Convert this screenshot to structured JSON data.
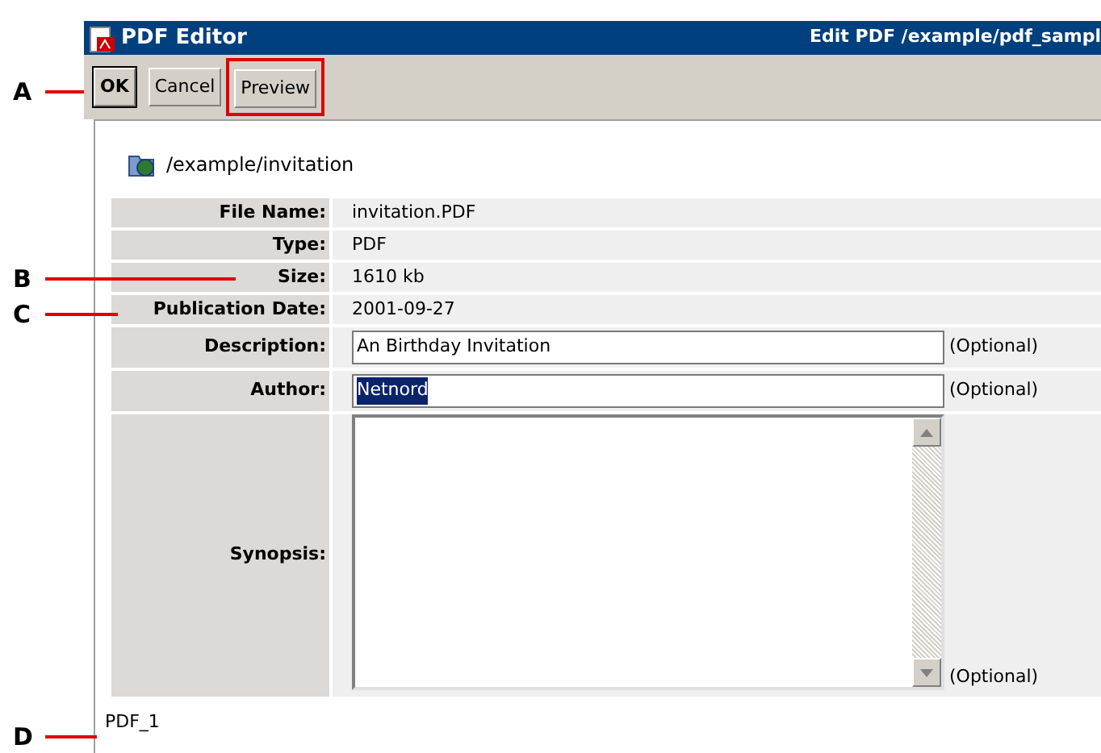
{
  "window": {
    "title": "PDF Editor",
    "subtitle": "Edit PDF /example/pdf_sampl"
  },
  "buttons": [
    {
      "label": "OK",
      "default": true,
      "highlighted": false
    },
    {
      "label": "Cancel",
      "default": false,
      "highlighted": false
    },
    {
      "label": "Preview",
      "default": false,
      "highlighted": true
    }
  ],
  "path": "/example/invitation",
  "fields": [
    {
      "kind": "static",
      "label": "File Name:",
      "value": "invitation.PDF"
    },
    {
      "kind": "static",
      "label": "Type:",
      "value": "PDF"
    },
    {
      "kind": "static",
      "label": "Size:",
      "value": "1610 kb"
    },
    {
      "kind": "static",
      "label": "Publication Date:",
      "value": "2001-09-27"
    },
    {
      "kind": "input",
      "label": "Description:",
      "value": "An Birthday Invitation",
      "selected": false,
      "note": "(Optional)"
    },
    {
      "kind": "input",
      "label": "Author:",
      "value": "Netnord",
      "selected": true,
      "note": "(Optional)"
    },
    {
      "kind": "textarea",
      "label": "Synopsis:",
      "note": "(Optional)"
    }
  ],
  "footer": "PDF_1",
  "callouts": [
    {
      "label": "A"
    },
    {
      "label": "B"
    },
    {
      "label": "C"
    },
    {
      "label": "D"
    }
  ]
}
